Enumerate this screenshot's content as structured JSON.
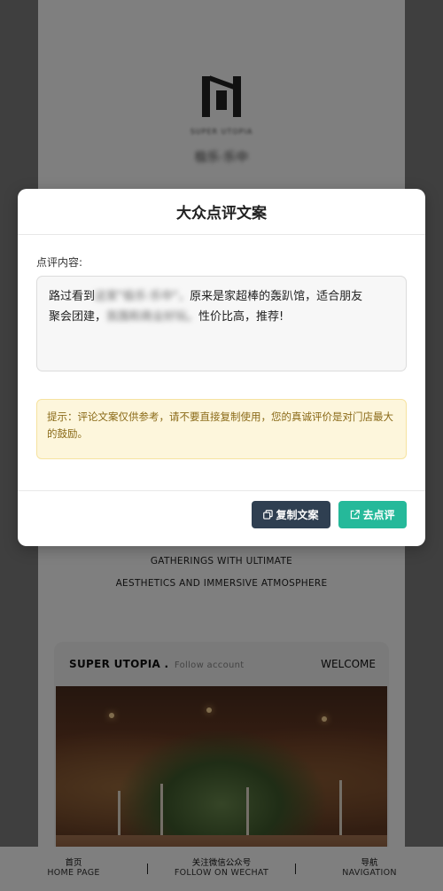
{
  "page": {
    "tagline_lines": [
      "GATHERINGS WITH ULTIMATE",
      "AESTHETICS AND IMMERSIVE ATMOSPHERE"
    ],
    "card": {
      "brand": "SUPER UTOPIA .",
      "follow": "Follow account",
      "welcome": "WELCOME"
    }
  },
  "modal": {
    "title": "大众点评文案",
    "review_label": "点评内容:",
    "review_text": {
      "line1_start": "路过看到",
      "line1_blurred": "这家\"极乐·乐中\"，",
      "line1_end": "原来是家超棒的轰趴馆，适合朋友",
      "line2_start": "聚会团建，",
      "line2_blurred": "氛围和商业好玩。",
      "line2_end": "性价比高，推荐!"
    },
    "tip": "提示：评论文案仅供参考，请不要直接复制使用，您的真诚评价是对门店最大的鼓励。",
    "copy_button": "复制文案",
    "review_button": "去点评"
  },
  "bottom_nav": [
    {
      "cn": "首页",
      "en": "HOME PAGE"
    },
    {
      "cn": "关注微信公众号",
      "en": "FOLLOW ON WECHAT"
    },
    {
      "cn": "导航",
      "en": "NAVIGATION"
    }
  ],
  "colors": {
    "copy_button": "#2f3f51",
    "review_button": "#25b99a",
    "tip_background": "#fdf6dc",
    "tip_text": "#8a6a18"
  }
}
